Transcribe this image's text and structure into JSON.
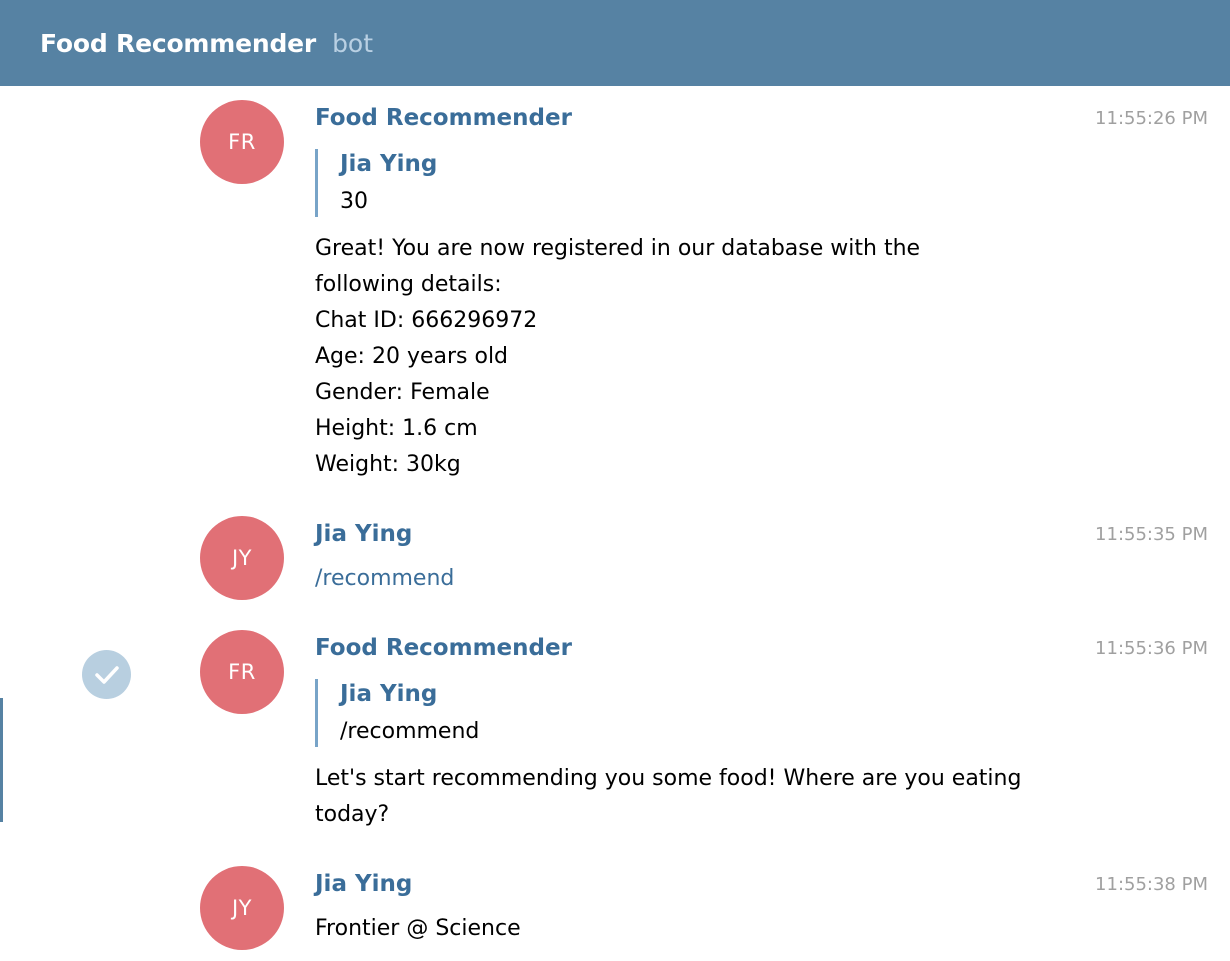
{
  "header": {
    "title": "Food Recommender",
    "subtitle": "bot"
  },
  "messages": [
    {
      "avatar": "FR",
      "sender": "Food Recommender",
      "time": "11:55:26 PM",
      "reply": {
        "name": "Jia Ying",
        "text": "30"
      },
      "lines": [
        "Great! You are now registered in our database with the",
        "following details:",
        "Chat ID: 666296972",
        "Age: 20 years old",
        "Gender: Female",
        "Height: 1.6 cm",
        "Weight: 30kg"
      ]
    },
    {
      "avatar": "JY",
      "sender": "Jia Ying",
      "time": "11:55:35 PM",
      "command": "/recommend"
    },
    {
      "avatar": "FR",
      "sender": "Food Recommender",
      "time": "11:55:36 PM",
      "selected": true,
      "reply": {
        "name": "Jia Ying",
        "text": "/recommend"
      },
      "lines": [
        "Let's start recommending you some food! Where are you eating",
        "today?"
      ]
    },
    {
      "avatar": "JY",
      "sender": "Jia Ying",
      "time": "11:55:38 PM",
      "lines": [
        "Frontier @ Science"
      ]
    }
  ],
  "icons": {
    "selected_check": "check-icon"
  },
  "colors": {
    "header_bg": "#5682a3",
    "avatar_bg": "#e17076",
    "sender_name": "#3a6d99",
    "quote_bar": "#78a4c8",
    "check_bg": "#b8cfe0"
  }
}
